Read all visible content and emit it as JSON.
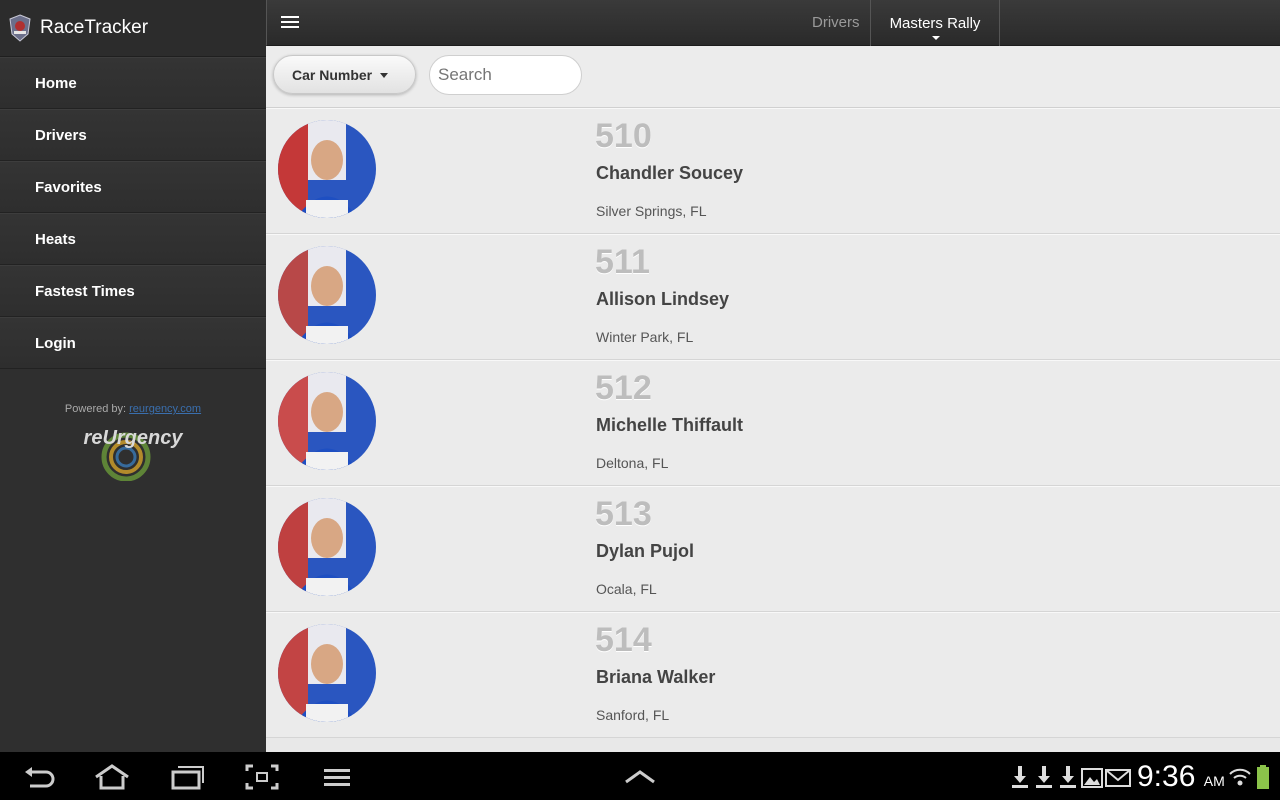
{
  "app": {
    "title": "RaceTracker"
  },
  "sidebar": {
    "items": [
      {
        "label": "Home"
      },
      {
        "label": "Drivers"
      },
      {
        "label": "Favorites"
      },
      {
        "label": "Heats"
      },
      {
        "label": "Fastest Times"
      },
      {
        "label": "Login"
      }
    ],
    "powered_by_label": "Powered by:",
    "powered_by_link": "reurgency.com",
    "brand_name": "reUrgency"
  },
  "topbar": {
    "breadcrumb": "Drivers",
    "event": "Masters Rally"
  },
  "filter": {
    "sort_label": "Car Number",
    "search_placeholder": "Search"
  },
  "drivers": [
    {
      "car": "510",
      "name": "Chandler Soucey",
      "location": "Silver Springs, FL"
    },
    {
      "car": "511",
      "name": "Allison Lindsey",
      "location": "Winter Park, FL"
    },
    {
      "car": "512",
      "name": "Michelle Thiffault",
      "location": "Deltona, FL"
    },
    {
      "car": "513",
      "name": "Dylan Pujol",
      "location": "Ocala, FL"
    },
    {
      "car": "514",
      "name": "Briana Walker",
      "location": "Sanford, FL"
    }
  ],
  "system": {
    "time": "9:36",
    "ampm": "AM"
  },
  "colors": {
    "accent": "#3a6fae",
    "sidebar_bg": "#2f2f2f",
    "list_bg": "#ebebeb"
  }
}
